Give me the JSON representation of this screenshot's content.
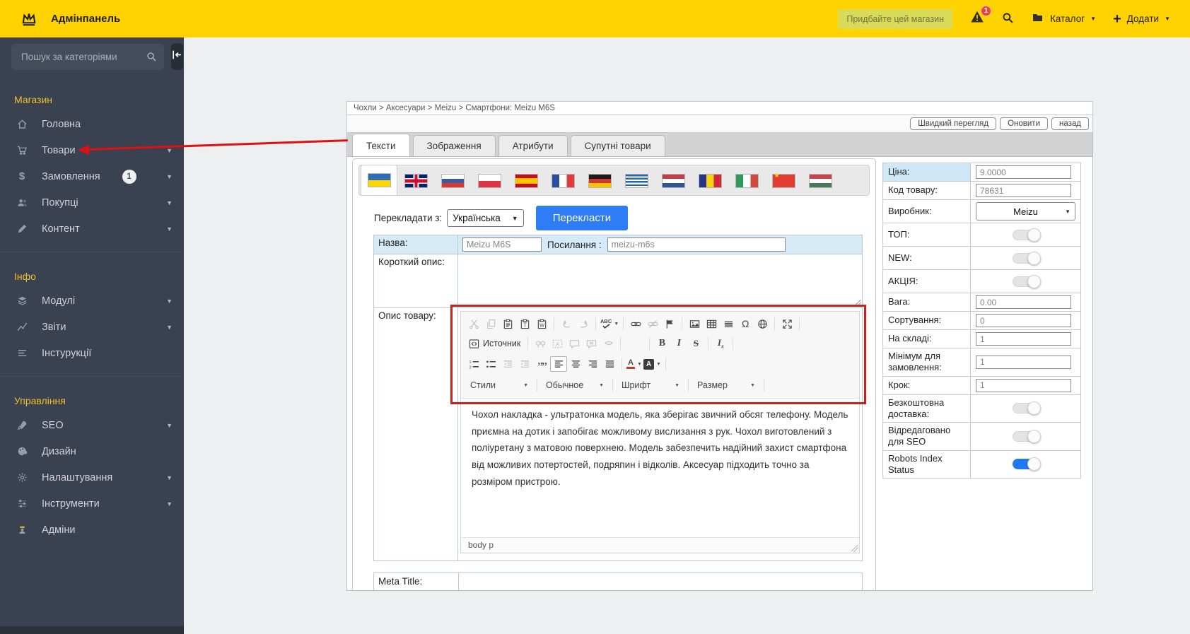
{
  "colors": {
    "topbar_yellow": "#ffd200",
    "sidebar_bg": "#3a4150",
    "section_title_yellow": "#efc12c",
    "accent_blue": "#2f7df6",
    "toggle_on_blue": "#2178f3",
    "row_highlight_blue": "#d6ebf7",
    "annotation_red": "#dd1111"
  },
  "topbar": {
    "title": "Адмінпанель",
    "buy_button": "Придбайте цей магазин",
    "notification_count": "1",
    "catalog_label": "Каталог",
    "add_label": "Додати"
  },
  "sidebar": {
    "search_placeholder": "Пошук за категоріями",
    "sections": [
      {
        "title": "Магазин",
        "items": [
          {
            "id": "home",
            "label": "Головна",
            "icon": "home-icon"
          },
          {
            "id": "products",
            "label": "Товари",
            "icon": "cart-icon",
            "chevron": true
          },
          {
            "id": "orders",
            "label": "Замовлення",
            "icon": "dollar-icon",
            "badge": "1",
            "chevron": true
          },
          {
            "id": "customers",
            "label": "Покупці",
            "icon": "users-icon",
            "chevron": true
          },
          {
            "id": "content",
            "label": "Контент",
            "icon": "pencil-icon",
            "chevron": true
          }
        ]
      },
      {
        "title": "Інфо",
        "items": [
          {
            "id": "modules",
            "label": "Модулі",
            "icon": "layers-icon",
            "chevron": true
          },
          {
            "id": "reports",
            "label": "Звіти",
            "icon": "chart-icon",
            "chevron": true
          },
          {
            "id": "instructions",
            "label": "Інстурукції",
            "icon": "list-icon"
          }
        ]
      },
      {
        "title": "Управління",
        "items": [
          {
            "id": "seo",
            "label": "SEO",
            "icon": "rocket-icon",
            "chevron": true
          },
          {
            "id": "design",
            "label": "Дизайн",
            "icon": "palette-icon"
          },
          {
            "id": "settings",
            "label": "Налаштування",
            "icon": "gear-icon",
            "chevron": true
          },
          {
            "id": "tools",
            "label": "Інструменти",
            "icon": "sliders-icon",
            "chevron": true
          },
          {
            "id": "admins",
            "label": "Адміни",
            "icon": "admin-icon"
          }
        ]
      }
    ]
  },
  "panel": {
    "breadcrumb": "Чохли > Аксесуари > Meizu > Смартфони: Meizu M6S",
    "actions": [
      "Швидкий перегляд",
      "Оновити",
      "назад"
    ],
    "tabs": [
      "Тексти",
      "Зображення",
      "Атрибути",
      "Супутні товари"
    ],
    "active_tab": "Тексти"
  },
  "languages": [
    "ua",
    "gb",
    "ru",
    "pl",
    "es",
    "fr",
    "de",
    "gr",
    "nl",
    "ro",
    "it",
    "cn",
    "hu"
  ],
  "translate": {
    "label": "Перекладати з:",
    "language": "Українська",
    "button": "Перекласти"
  },
  "form": {
    "name_label": "Назва:",
    "name_value": "Meizu M6S",
    "link_label": "Посилання :",
    "link_value": "meizu-m6s",
    "short_desc_label": "Короткий опис:",
    "desc_label": "Опис товару:",
    "meta_title_label": "Meta Title:"
  },
  "editor": {
    "source_label": "Источник",
    "toolbar": {
      "row1": [
        {
          "icon": "cut-icon",
          "disabled": true
        },
        {
          "icon": "copy-icon",
          "disabled": true
        },
        {
          "icon": "paste-icon"
        },
        {
          "icon": "paste-text-icon"
        },
        {
          "icon": "paste-word-icon"
        },
        {
          "sep": true
        },
        {
          "icon": "undo-icon",
          "disabled": true
        },
        {
          "icon": "redo-icon",
          "disabled": true
        },
        {
          "sep": true
        },
        {
          "icon": "spellcheck-icon",
          "caret": true
        },
        {
          "sep": true
        },
        {
          "icon": "link-icon"
        },
        {
          "icon": "unlink-icon",
          "disabled": true
        },
        {
          "icon": "anchor-icon"
        },
        {
          "sep": true
        },
        {
          "icon": "image-icon"
        },
        {
          "icon": "table-icon"
        },
        {
          "icon": "hr-icon"
        },
        {
          "icon": "omega-icon"
        },
        {
          "icon": "globe-icon"
        },
        {
          "sep": true
        },
        {
          "icon": "maximize-icon"
        },
        {
          "sep": true
        }
      ],
      "row2": [
        {
          "icon": "source-icon",
          "with_label": true
        },
        {
          "sep": true
        },
        {
          "icon": "find-icon",
          "disabled": true
        },
        {
          "icon": "replace-icon",
          "disabled": true
        },
        {
          "icon": "scayt-icon",
          "disabled": true
        },
        {
          "icon": "scayt-off-icon",
          "disabled": true
        },
        {
          "icon": "codeview-icon",
          "disabled": true
        },
        {
          "sep": true
        },
        {
          "gap": true
        },
        {
          "sep": true
        },
        {
          "icon": "bold-icon"
        },
        {
          "icon": "italic-icon"
        },
        {
          "icon": "strike-icon"
        },
        {
          "sep": true
        },
        {
          "icon": "removeformat-icon"
        },
        {
          "sep": true
        }
      ],
      "row3": [
        {
          "icon": "numbered-list-icon"
        },
        {
          "icon": "bullet-list-icon"
        },
        {
          "icon": "outdent-icon",
          "disabled": true
        },
        {
          "icon": "indent-icon",
          "disabled": true
        },
        {
          "icon": "blockquote-icon"
        },
        {
          "icon": "align-left-icon",
          "active": true
        },
        {
          "icon": "align-center-icon"
        },
        {
          "icon": "align-right-icon"
        },
        {
          "icon": "justify-icon"
        },
        {
          "sep": true
        },
        {
          "icon": "text-color-icon",
          "caret": true
        },
        {
          "icon": "bg-color-icon",
          "caret": true
        },
        {
          "sep": true
        }
      ],
      "dropdowns": [
        "Стили",
        "Обычное",
        "Шрифт",
        "Размер"
      ]
    },
    "text": "Чохол накладка - ультратонка модель, яка зберігає звичний обсяг телефону. Модель приємна на дотик і запобігає можливому вислизання з рук. Чохол виготовлений з поліуретану з матовою поверхнею. Модель забезпечить надійний захист смартфона від можливих потертостей, подряпин і відколів. Аксесуар підходить точно за розміром пристрою.",
    "path": "body  p"
  },
  "properties": {
    "rows": [
      {
        "label": "Ціна:",
        "type": "input",
        "value": "9.0000",
        "highlight": true
      },
      {
        "label": "Код товару:",
        "type": "input",
        "value": "78631"
      },
      {
        "label": "Виробник:",
        "type": "select",
        "value": "Meizu"
      },
      {
        "label": "ТОП:",
        "type": "toggle",
        "on": false,
        "tall": true
      },
      {
        "label": "NEW:",
        "type": "toggle",
        "on": false,
        "tall": true
      },
      {
        "label": "АКЦІЯ:",
        "type": "toggle",
        "on": false,
        "tall": true
      },
      {
        "label": "Вага:",
        "type": "input",
        "value": "0.00"
      },
      {
        "label": "Сортування:",
        "type": "input",
        "value": "0"
      },
      {
        "label": "На складі:",
        "type": "input",
        "value": "1"
      },
      {
        "label": "Мінімум для замовлення:",
        "type": "input",
        "value": "1"
      },
      {
        "label": "Крок:",
        "type": "input",
        "value": "1"
      },
      {
        "label": "Безкоштовна доставка:",
        "type": "toggle",
        "on": false
      },
      {
        "label": "Відредаговано для SEO",
        "type": "toggle",
        "on": false
      },
      {
        "label": "Robots Index Status",
        "type": "toggle",
        "on": true
      }
    ]
  }
}
